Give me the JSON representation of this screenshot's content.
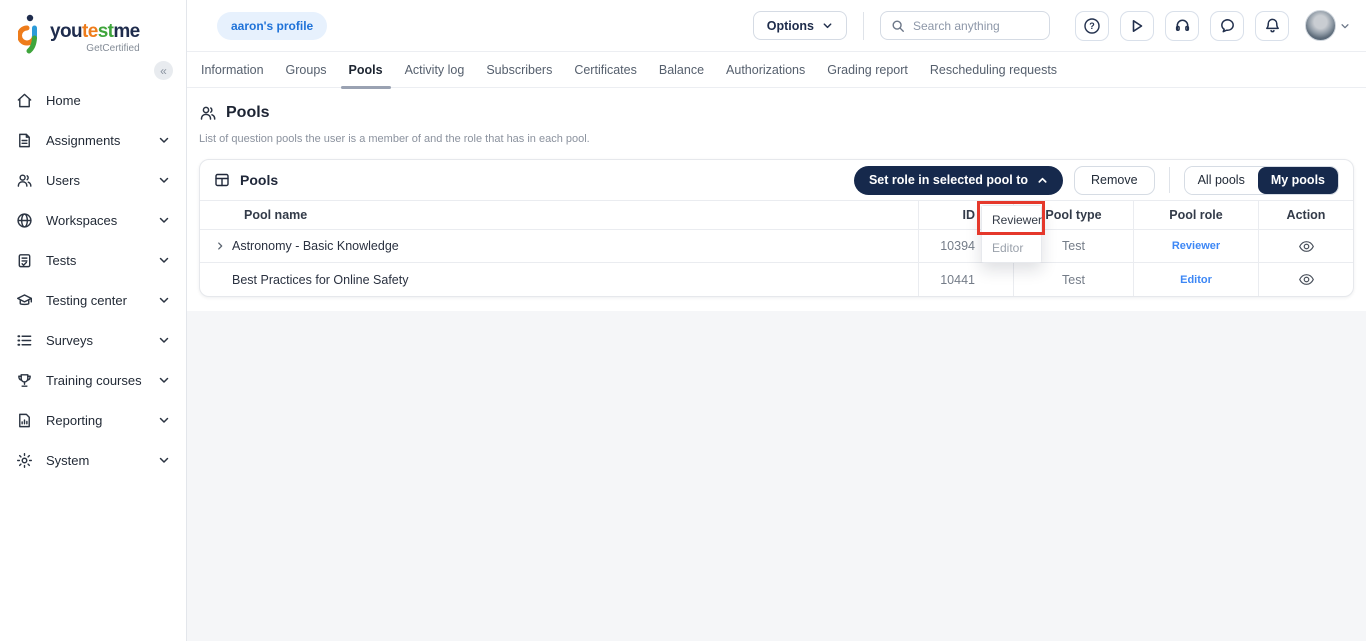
{
  "colors": {
    "accent_navy": "#16294c",
    "chip_blue": "#1f72d8",
    "role_link_blue": "#3d87f5",
    "highlight_red": "#e5382b"
  },
  "brand": {
    "name_you": "you",
    "name_te": "te",
    "name_st": "st",
    "name_me": "me",
    "tagline": "GetCertified",
    "collapse_glyph": "«"
  },
  "topbar": {
    "profile_chip": "aaron's profile",
    "options_label": "Options",
    "search_placeholder": "Search anything",
    "help_glyph": "?"
  },
  "sidebar": {
    "items": [
      {
        "label": "Home",
        "icon": "home-icon"
      },
      {
        "label": "Assignments",
        "icon": "document-icon"
      },
      {
        "label": "Users",
        "icon": "users-icon"
      },
      {
        "label": "Workspaces",
        "icon": "globe-icon"
      },
      {
        "label": "Tests",
        "icon": "clipboard-icon"
      },
      {
        "label": "Testing center",
        "icon": "graduation-cap-icon"
      },
      {
        "label": "Surveys",
        "icon": "list-icon"
      },
      {
        "label": "Training courses",
        "icon": "trophy-icon"
      },
      {
        "label": "Reporting",
        "icon": "report-icon"
      },
      {
        "label": "System",
        "icon": "gear-icon"
      }
    ]
  },
  "tabs": [
    {
      "label": "Information"
    },
    {
      "label": "Groups"
    },
    {
      "label": "Pools",
      "active": true
    },
    {
      "label": "Activity log"
    },
    {
      "label": "Subscribers"
    },
    {
      "label": "Certificates"
    },
    {
      "label": "Balance"
    },
    {
      "label": "Authorizations"
    },
    {
      "label": "Grading report"
    },
    {
      "label": "Rescheduling requests"
    }
  ],
  "page": {
    "title": "Pools",
    "description": "List of question pools the user is a member of and the role that has in each pool."
  },
  "pools_card": {
    "title": "Pools",
    "set_role_button": "Set role in selected pool to",
    "remove_button": "Remove",
    "filter_all": "All pools",
    "filter_my": "My pools",
    "active_filter": "My pools"
  },
  "pools_table": {
    "columns": {
      "name": "Pool name",
      "id": "ID",
      "type": "Pool type",
      "role": "Pool role",
      "action": "Action"
    },
    "rows": [
      {
        "name": "Astronomy - Basic Knowledge",
        "id": "10394",
        "type": "Test",
        "role": "Reviewer",
        "expandable": true
      },
      {
        "name": "Best Practices for Online Safety",
        "id": "10441",
        "type": "Test",
        "role": "Editor",
        "expandable": false
      }
    ]
  },
  "role_dropdown": {
    "options": [
      {
        "label": "Reviewer",
        "highlighted": true
      },
      {
        "label": "Editor",
        "highlighted": false
      }
    ]
  }
}
